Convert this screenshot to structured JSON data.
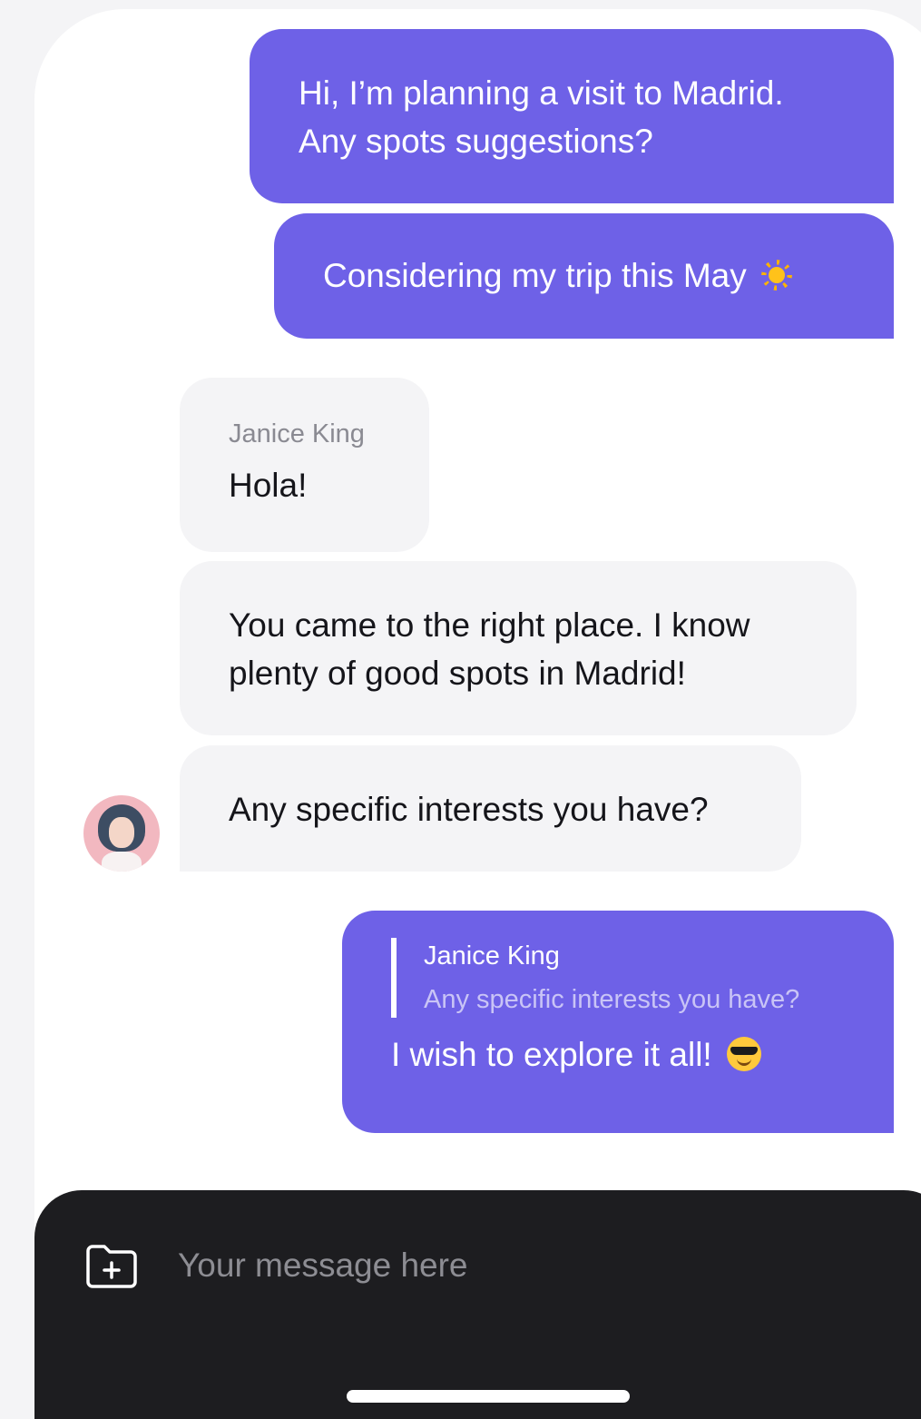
{
  "messages": [
    {
      "direction": "outgoing",
      "lines": [
        "Hi, I’m planning a visit to Madrid.",
        "Any spots suggestions?"
      ]
    },
    {
      "direction": "outgoing",
      "text": "Considering my trip this May",
      "emoji": "sun-icon"
    },
    {
      "direction": "incoming",
      "sender": "Janice King",
      "text": "Hola!"
    },
    {
      "direction": "incoming",
      "lines": [
        "You came to the right place. I know",
        "plenty of good spots in Madrid!"
      ]
    },
    {
      "direction": "incoming",
      "text": "Any specific interests you have?"
    },
    {
      "direction": "outgoing",
      "quote": {
        "name": "Janice King",
        "text": "Any specific interests you have?"
      },
      "text": "I wish to explore it all!",
      "emoji": "cool-face-icon"
    }
  ],
  "composer": {
    "placeholder": "Your message here",
    "attach_icon": "add-folder-icon"
  },
  "colors": {
    "outgoing_bubble": "#6e61e7",
    "incoming_bubble": "#f4f4f6",
    "composer_background": "#1d1d20"
  }
}
